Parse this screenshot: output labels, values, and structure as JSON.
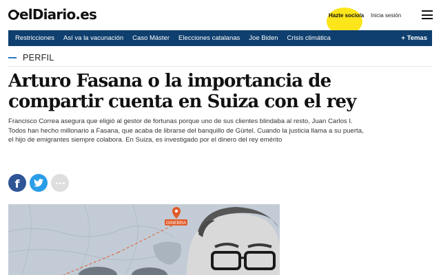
{
  "header": {
    "logo_text": "elDiario.es",
    "subscribe_label": "Hazte socio/a",
    "login_label": "Inicia sesión"
  },
  "nav": {
    "items": [
      {
        "label": "Restricciones"
      },
      {
        "label": "Así va la vacunación"
      },
      {
        "label": "Caso Máster"
      },
      {
        "label": "Elecciones catalanas"
      },
      {
        "label": "Joe Biden"
      },
      {
        "label": "Crisis climática"
      }
    ],
    "topics_label": "+ Temas"
  },
  "article": {
    "kicker": "PERFIL",
    "headline": "Arturo Fasana o la importancia de compartir cuenta en Suiza con el rey",
    "summary": "Francisco Correa asegura que eligió al gestor de fortunas porque uno de sus clientes blindaba al resto, Juan Carlos I. Todos han hecho millonario a Fasana, que acaba de librarse del banquillo de Gürtel. Cuando la justicia llama a su puerta, el hijo de emigrantes siempre colabora. En Suiza, es investigado por el dinero del rey emérito",
    "map_label": "GINEBRA"
  },
  "share": {
    "icons": [
      "facebook-icon",
      "twitter-icon",
      "more-icon"
    ]
  },
  "colors": {
    "nav_bg": "#0e3f6e",
    "subscribe_highlight": "#fde51b",
    "kicker_accent": "#2778c2",
    "facebook": "#2f5597",
    "twitter": "#2a9de8",
    "map_marker": "#e05b2a"
  }
}
